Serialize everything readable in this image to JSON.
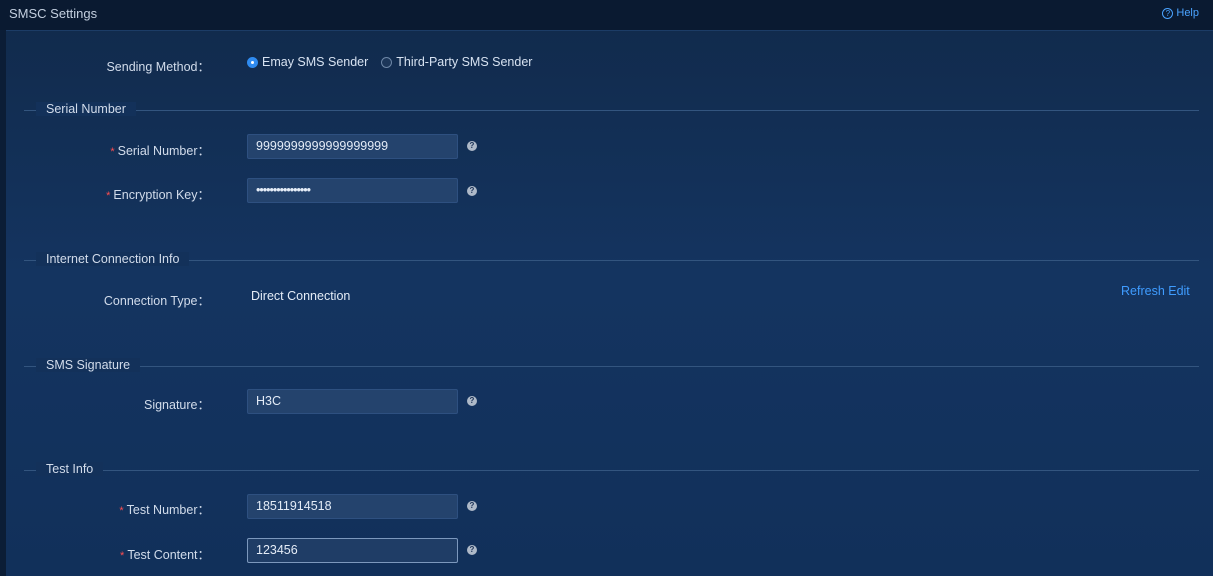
{
  "header": {
    "title": "SMSC Settings",
    "help_label": "Help"
  },
  "sending_method": {
    "label": "Sending Method：",
    "options": [
      "Emay SMS Sender",
      "Third-Party SMS Sender"
    ],
    "selected": "Emay SMS Sender"
  },
  "serial_section": {
    "title": "Serial Number",
    "serial_label": "Serial Number：",
    "serial_value": "9999999999999999999",
    "key_label": "Encryption Key：",
    "key_value": "••••••••••••••••"
  },
  "internet_section": {
    "title": "Internet Connection Info",
    "type_label": "Connection Type：",
    "type_value": "Direct Connection",
    "refresh_edit": "Refresh Edit"
  },
  "signature_section": {
    "title": "SMS Signature",
    "signature_label": "Signature：",
    "signature_value": "H3C"
  },
  "test_section": {
    "title": "Test Info",
    "number_label": "Test Number：",
    "number_value": "18511914518",
    "content_label": "Test Content：",
    "content_value": "123456"
  },
  "icons": {
    "help": "help-circle-icon",
    "question": "question-icon"
  },
  "colors": {
    "accent": "#2f8bf0",
    "link": "#3f9cff",
    "required": "#ff4d4f"
  }
}
